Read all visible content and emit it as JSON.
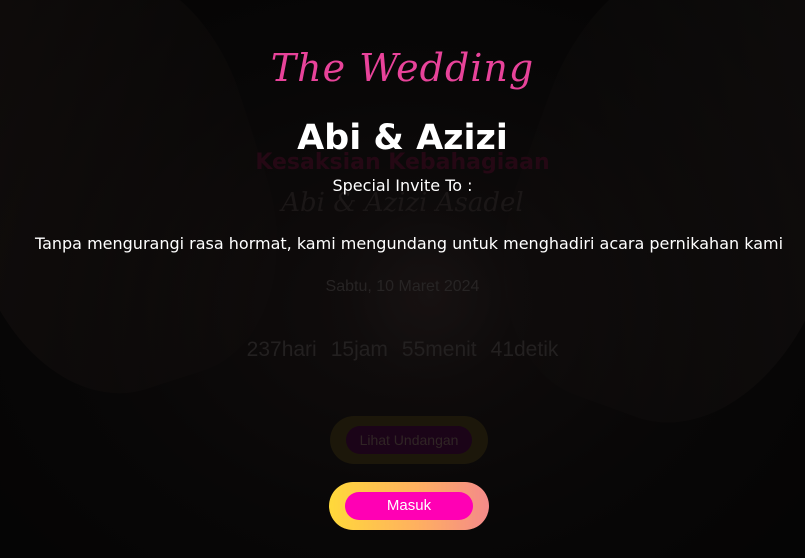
{
  "underlying": {
    "title": "Kesaksian Kebahagiaan",
    "names": "Abi & Azizi Asadel",
    "date": "Sabtu, 10 Maret 2024",
    "countdown": [
      {
        "value": "237",
        "unit": "hari"
      },
      {
        "value": "15",
        "unit": "jam"
      },
      {
        "value": "55",
        "unit": "menit"
      },
      {
        "value": "41",
        "unit": "detik"
      }
    ],
    "view_button_label": "Lihat Undangan"
  },
  "modal": {
    "script_title": "The Wedding",
    "couple_names": "Abi & Azizi",
    "invite_label": "Special Invite To :",
    "message": "Tanpa mengurangi rasa hormat, kami mengundang untuk menghadiri acara pernikahan kami",
    "enter_button_label": "Masuk"
  },
  "colors": {
    "accent_pink": "#e8439a",
    "button_magenta": "#ff00b4",
    "gradient_start": "#ffd93a",
    "gradient_end": "#f48a8a"
  }
}
